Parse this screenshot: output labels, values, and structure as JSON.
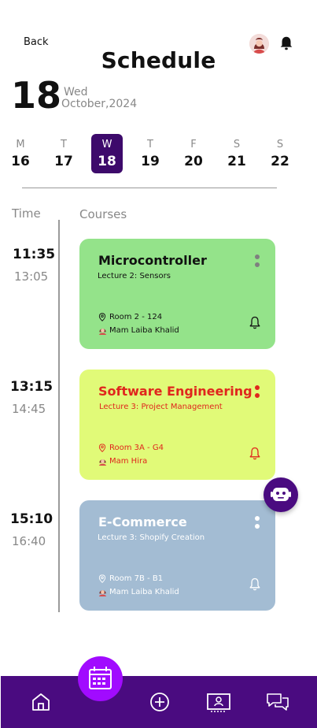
{
  "header": {
    "back_label": "Back",
    "title": "Schedule"
  },
  "date": {
    "day": "18",
    "weekday": "Wed",
    "month_year": "October,2024"
  },
  "week": [
    {
      "letter": "M",
      "num": "16"
    },
    {
      "letter": "T",
      "num": "17"
    },
    {
      "letter": "W",
      "num": "18"
    },
    {
      "letter": "T",
      "num": "19"
    },
    {
      "letter": "F",
      "num": "20"
    },
    {
      "letter": "S",
      "num": "21"
    },
    {
      "letter": "S",
      "num": "22"
    }
  ],
  "columns": {
    "time": "Time",
    "courses": "Courses"
  },
  "courses": [
    {
      "start": "11:35",
      "end": "13:05",
      "title": "Microcontroller",
      "lecture": "Lecture 2: Sensors",
      "room": "Room 2 - 124",
      "teacher": "Mam Laiba Khalid",
      "bg": "#94e38a",
      "fg": "#111111"
    },
    {
      "start": "13:15",
      "end": "14:45",
      "title": "Software Engineering",
      "lecture": "Lecture 3: Project Management",
      "room": "Room 3A - G4",
      "teacher": "Mam Hira",
      "bg": "#e1fa78",
      "fg": "#e0261d"
    },
    {
      "start": "15:10",
      "end": "16:40",
      "title": "E-Commerce",
      "lecture": "Lecture 3: Shopify Creation",
      "room": "Room 7B - B1",
      "teacher": "Mam Laiba Khalid",
      "bg": "#a3bcd3",
      "fg": "#ffffff"
    }
  ],
  "nav": {
    "items": [
      "home-icon",
      "calendar-icon",
      "add-icon",
      "classroom-icon",
      "chat-icon"
    ],
    "active": "calendar-icon",
    "bar_color": "#4a0b80",
    "active_color": "#a10bff"
  },
  "colors": {
    "accent": "#3d0a6b"
  }
}
